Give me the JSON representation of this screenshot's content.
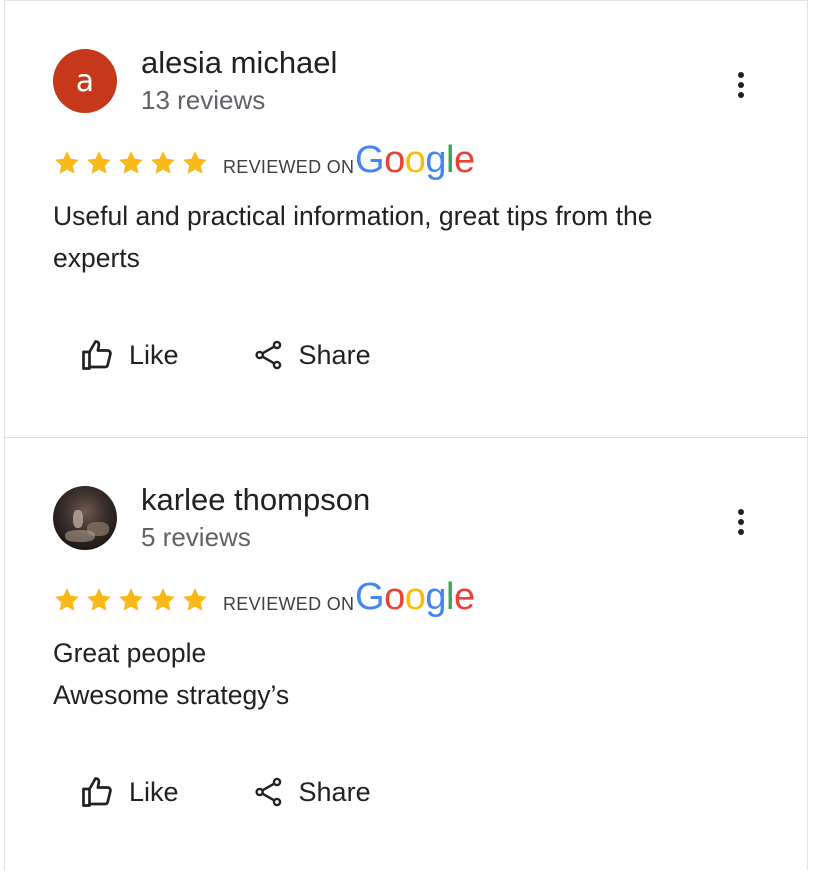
{
  "reviews": [
    {
      "avatar_letter": "a",
      "avatar_color": "#C5391A",
      "name": "alesia michael",
      "review_count": "13 reviews",
      "rating": 5,
      "reviewed_on": "REVIEWED ON",
      "source": "Google",
      "text_lines": [
        "Useful and practical information, great tips from the",
        "experts"
      ],
      "like_label": "Like",
      "share_label": "Share"
    },
    {
      "avatar_letter": "",
      "avatar_color": "#3a2e29",
      "name": "karlee thompson",
      "review_count": "5 reviews",
      "rating": 5,
      "reviewed_on": "REVIEWED ON",
      "source": "Google",
      "text_lines": [
        "Great people",
        "Awesome strategy’s"
      ],
      "like_label": "Like",
      "share_label": "Share"
    }
  ],
  "icons": {
    "star": "star-icon",
    "like": "thumbs-up-icon",
    "share": "share-icon",
    "menu": "more-vert-icon"
  },
  "colors": {
    "star": "#F9B918",
    "google_blue": "#4285F4",
    "google_red": "#EA4335",
    "google_yellow": "#FBBC05",
    "google_green": "#34A853"
  }
}
